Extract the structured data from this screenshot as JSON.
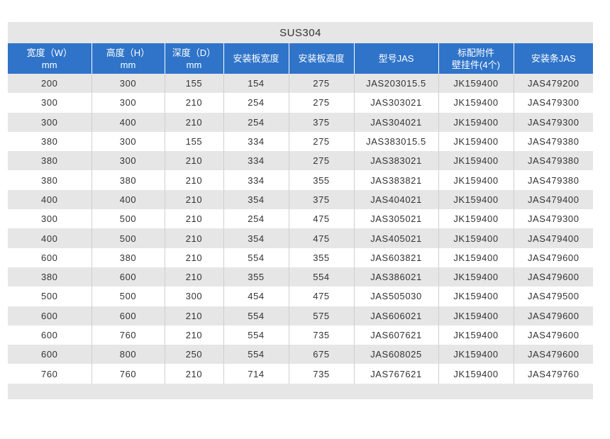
{
  "title": "SUS304",
  "headers": [
    {
      "line1": "宽度（W）",
      "line2": "mm"
    },
    {
      "line1": "高度（H）",
      "line2": "mm"
    },
    {
      "line1": "深度（D）",
      "line2": "mm"
    },
    {
      "line1": "安装板宽度",
      "line2": ""
    },
    {
      "line1": "安装板高度",
      "line2": ""
    },
    {
      "line1": "型号JAS",
      "line2": ""
    },
    {
      "line1": "标配附件",
      "line2": "壁挂件(4个)"
    },
    {
      "line1": "安装条JAS",
      "line2": ""
    }
  ],
  "rows": [
    [
      "200",
      "300",
      "155",
      "154",
      "275",
      "JAS203015.5",
      "JK159400",
      "JAS479200"
    ],
    [
      "300",
      "300",
      "210",
      "254",
      "275",
      "JAS303021",
      "JK159400",
      "JAS479300"
    ],
    [
      "300",
      "400",
      "210",
      "254",
      "375",
      "JAS304021",
      "JK159400",
      "JAS479300"
    ],
    [
      "380",
      "300",
      "155",
      "334",
      "275",
      "JAS383015.5",
      "JK159400",
      "JAS479380"
    ],
    [
      "380",
      "300",
      "210",
      "334",
      "275",
      "JAS383021",
      "JK159400",
      "JAS479380"
    ],
    [
      "380",
      "380",
      "210",
      "334",
      "355",
      "JAS383821",
      "JK159400",
      "JAS479380"
    ],
    [
      "400",
      "400",
      "210",
      "354",
      "375",
      "JAS404021",
      "JK159400",
      "JAS479400"
    ],
    [
      "300",
      "500",
      "210",
      "254",
      "475",
      "JAS305021",
      "JK159400",
      "JAS479300"
    ],
    [
      "400",
      "500",
      "210",
      "354",
      "475",
      "JAS405021",
      "JK159400",
      "JAS479400"
    ],
    [
      "600",
      "380",
      "210",
      "554",
      "355",
      "JAS603821",
      "JK159400",
      "JAS479600"
    ],
    [
      "380",
      "600",
      "210",
      "355",
      "554",
      "JAS386021",
      "JK159400",
      "JAS479600"
    ],
    [
      "500",
      "500",
      "300",
      "454",
      "475",
      "JAS505030",
      "JK159400",
      "JAS479500"
    ],
    [
      "600",
      "600",
      "210",
      "554",
      "575",
      "JAS606021",
      "JK159400",
      "JAS479600"
    ],
    [
      "600",
      "760",
      "210",
      "554",
      "735",
      "JAS607621",
      "JK159400",
      "JAS479600"
    ],
    [
      "600",
      "800",
      "250",
      "554",
      "675",
      "JAS608025",
      "JK159400",
      "JAS479600"
    ],
    [
      "760",
      "760",
      "210",
      "714",
      "735",
      "JAS767621",
      "JK159400",
      "JAS479760"
    ]
  ]
}
